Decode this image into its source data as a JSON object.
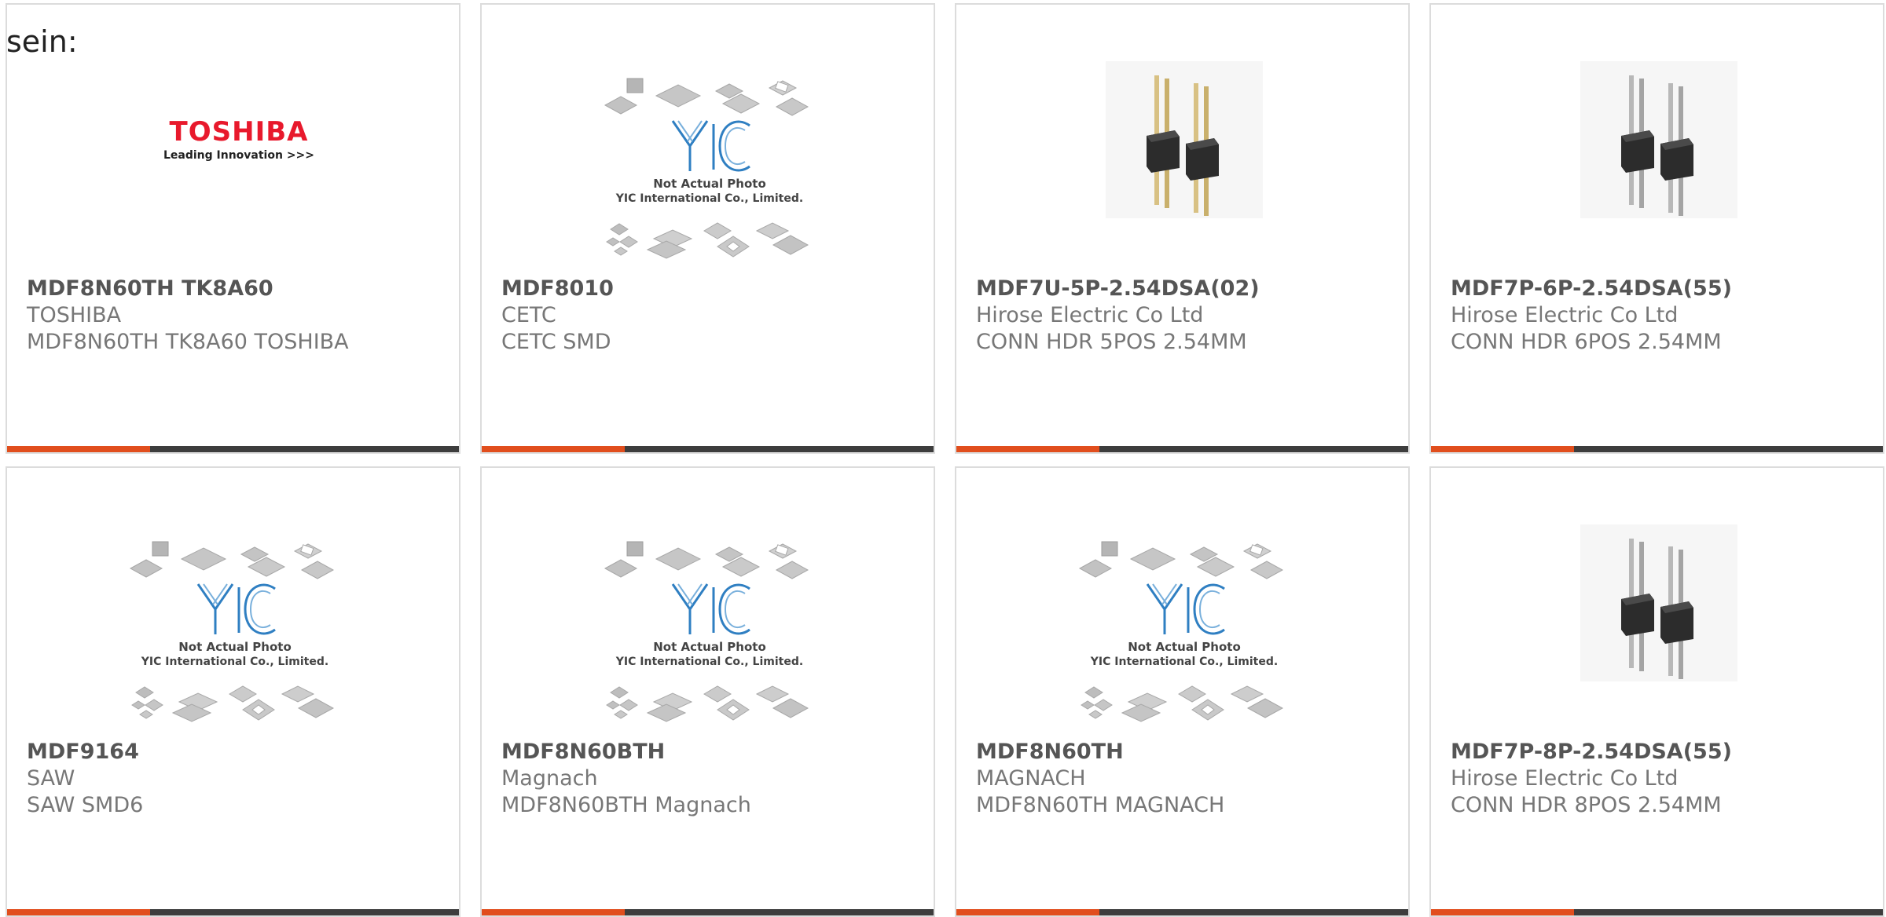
{
  "page": {
    "heading": "sein:"
  },
  "colors": {
    "accent": "#e14e1d",
    "bar": "#3d3d3d",
    "card_border": "#dcdcdc",
    "part_text": "#555555",
    "meta_text": "#777777",
    "toshiba_red": "#e8192c",
    "yic_blue": "#2f7fc2"
  },
  "placeholder_image": {
    "line1": "Not Actual Photo",
    "line2": "YIC International Co., Limited."
  },
  "toshiba_logo": {
    "word": "TOSHIBA",
    "tagline": "Leading Innovation >>>"
  },
  "products": [
    {
      "part": "MDF8N60TH TK8A60",
      "manufacturer": "TOSHIBA",
      "description": "MDF8N60TH TK8A60 TOSHIBA",
      "image": "toshiba-logo"
    },
    {
      "part": "MDF8010",
      "manufacturer": "CETC",
      "description": "CETC SMD",
      "image": "yic-placeholder"
    },
    {
      "part": "MDF7U-5P-2.54DSA(02)",
      "manufacturer": "Hirose Electric Co Ltd",
      "description": "CONN HDR 5POS 2.54MM",
      "image": "pin-header-gold"
    },
    {
      "part": "MDF7P-6P-2.54DSA(55)",
      "manufacturer": "Hirose Electric Co Ltd",
      "description": "CONN HDR 6POS 2.54MM",
      "image": "pin-header-silver"
    },
    {
      "part": "MDF9164",
      "manufacturer": "SAW",
      "description": "SAW SMD6",
      "image": "yic-placeholder"
    },
    {
      "part": "MDF8N60BTH",
      "manufacturer": "Magnach",
      "description": "MDF8N60BTH Magnach",
      "image": "yic-placeholder"
    },
    {
      "part": "MDF8N60TH",
      "manufacturer": "MAGNACH",
      "description": "MDF8N60TH MAGNACH",
      "image": "yic-placeholder"
    },
    {
      "part": "MDF7P-8P-2.54DSA(55)",
      "manufacturer": "Hirose Electric Co Ltd",
      "description": "CONN HDR 8POS 2.54MM",
      "image": "pin-header-silver"
    }
  ]
}
